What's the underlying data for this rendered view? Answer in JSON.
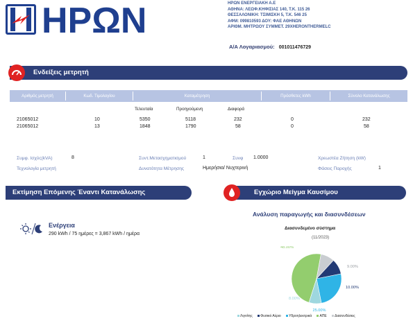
{
  "logo": {
    "text": "ΗΡΩΝ"
  },
  "company": {
    "lines": [
      "ΗΡΩΝ ΕΝΕΡΓΕΙΑΚΗ Α.Ε",
      "ΑΘΗΝΑ: ΛΕΩΦ.ΚΗΦΙΣΙΑΣ 140, Τ.Κ. 115 26",
      "ΘΕΣΣΑΛΟΝΙΚΗ: ΤΣΙΜΙΣΚΗ 5, Τ.Κ. 546 25",
      "ΑΦΜ: 099810593 ΔΟΥ: ΦΑΕ ΑΘΗΝΩΝ",
      "ΑΡΙΘΜ. ΜΗΤΡΩΟΥ ΣΥΜΜΕΤ. 29XHERONTHERMELC"
    ]
  },
  "account": {
    "label": "Α/Α Λογαριασμού:",
    "value": "001011476729"
  },
  "meter_section": {
    "title": "Ενδείξεις μετρητή",
    "headers": {
      "meter_no": "Αριθμός μετρητή",
      "tariff": "Κωδ. Τιμολογίου",
      "reading": "Καταμέτρηση",
      "extra_kwh": "Πρόσθετες kWh",
      "total": "Σύνολο Κατανάλωσης"
    },
    "subheaders": {
      "last": "Τελευταία",
      "previous": "Προηγούμενη",
      "diff": "Διαφορά"
    },
    "rows": [
      {
        "meter": "21065012",
        "tariff": "10",
        "last": "5350",
        "previous": "5118",
        "diff": "232",
        "extra": "0",
        "total": "232"
      },
      {
        "meter": "21065012",
        "tariff": "13",
        "last": "1848",
        "previous": "1790",
        "diff": "58",
        "extra": "0",
        "total": "58"
      }
    ]
  },
  "attributes": {
    "power_label": "Συμφ. Ισχύς(kVA)",
    "power_value": "8",
    "transformer_label": "Συντ.Μετασχηματισμού",
    "transformer_value": "1",
    "cosphi_label": "Συνφ",
    "cosphi_value": "1.0000",
    "demand_label": "Χρεωστέα Ζήτηση (kW)",
    "tech_label": "Τεχνολογία μετρητή",
    "capability_label": "Δυνατότητα Μέτρησης",
    "capability_value": "Ημερήσια/ Νυχτερινή",
    "phases_label": "Φάσεις Παροχής",
    "phases_value": "1"
  },
  "estimate_section": {
    "title": "Εκτίμηση Επόμενης Έναντι Κατανάλωσης",
    "energy_title": "Ενέργεια",
    "energy_text": "290 kWh / 75 ημέρες = 3,867 kWh / ημέρα"
  },
  "fuel_section": {
    "title": "Εγχώριο Μείγμα Καυσίμου",
    "analysis_title": "Ανάλυση παραγωγής και διασυνδέσεων",
    "system_label": "Διασυνδεμένο σύστημα",
    "period": "(11/2023)",
    "legend": [
      "Λιγνίτης",
      "Φυσικό Αέριο",
      "Υδροηλεκτρικά",
      "ΑΠΕ",
      "Διασυνδέσεις"
    ]
  },
  "colors": {
    "navy": "#2d3f78",
    "header_blue": "#b7c4e3",
    "red_badge": "#e02323",
    "label_blue": "#6a7fb5"
  },
  "chart_data": {
    "type": "pie",
    "title": "Διασυνδεμένο σύστημα",
    "subtitle": "(11/2023)",
    "slices": [
      {
        "name": "ΑΠΕ",
        "value": 48.0,
        "label": "48.00%",
        "color": "#93cd6e"
      },
      {
        "name": "Διασυνδέσεις",
        "value": 9.0,
        "label": "9.00%",
        "color": "#c9cdd1"
      },
      {
        "name": "Φυσικό Αέριο",
        "value": 10.0,
        "label": "10.00%",
        "color": "#223a74"
      },
      {
        "name": "Υδροηλεκτρικά",
        "value": 25.0,
        "label": "25.00%",
        "color": "#2fb4e6"
      },
      {
        "name": "Λιγνίτης",
        "value": 8.0,
        "label": "8.00%",
        "color": "#9ed7df"
      }
    ]
  }
}
